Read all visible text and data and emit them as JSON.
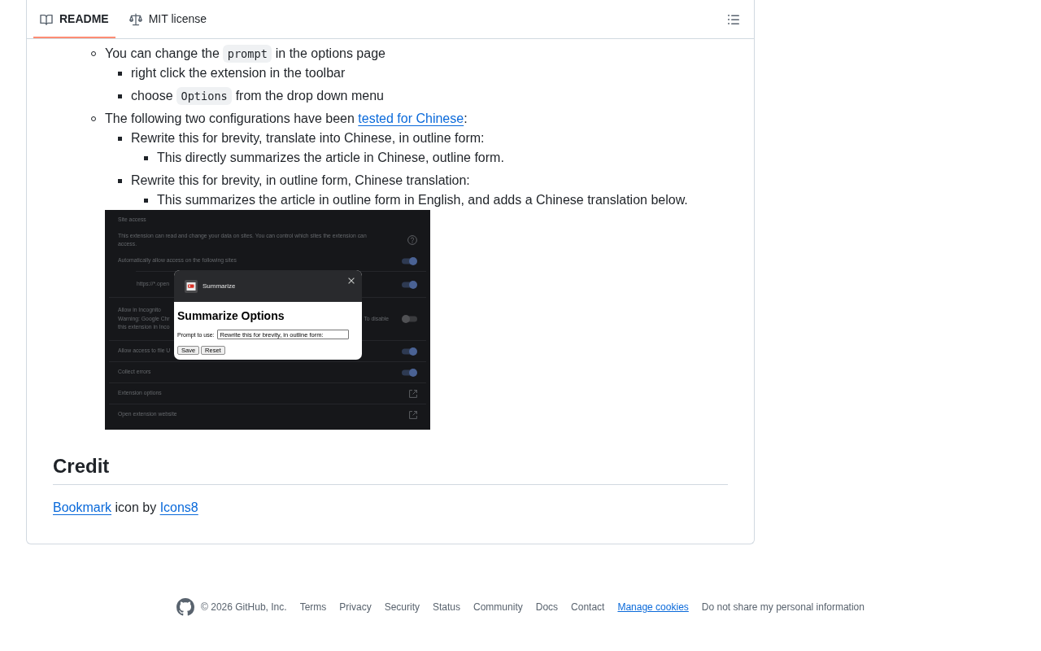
{
  "tabs": [
    {
      "label": "README",
      "selected": true
    },
    {
      "label": "MIT license",
      "selected": false
    }
  ],
  "readme": {
    "list": [
      {
        "parts": [
          {
            "kind": "text",
            "text": "You can change the "
          },
          {
            "kind": "code",
            "text": "prompt"
          },
          {
            "kind": "text",
            "text": " in the options page"
          }
        ],
        "children": [
          {
            "parts": [
              {
                "kind": "text",
                "text": "right click the extension in the toolbar"
              }
            ]
          },
          {
            "parts": [
              {
                "kind": "text",
                "text": "choose "
              },
              {
                "kind": "code",
                "text": "Options"
              },
              {
                "kind": "text",
                "text": " from the drop down menu"
              }
            ]
          }
        ]
      },
      {
        "parts": [
          {
            "kind": "text",
            "text": "The following two configurations have been "
          },
          {
            "kind": "link",
            "text": "tested for Chinese"
          },
          {
            "kind": "text",
            "text": ":"
          }
        ],
        "children": [
          {
            "parts": [
              {
                "kind": "text",
                "text": "Rewrite this for brevity, translate into Chinese, in outline form:"
              }
            ],
            "children": [
              {
                "parts": [
                  {
                    "kind": "text",
                    "text": "This directly summarizes the article in Chinese, outline form."
                  }
                ]
              }
            ]
          },
          {
            "parts": [
              {
                "kind": "text",
                "text": "Rewrite this for brevity, in outline form, Chinese translation:"
              }
            ],
            "children": [
              {
                "parts": [
                  {
                    "kind": "text",
                    "text": "This summarizes the article in outline form in English, and adds a Chinese translation below."
                  }
                ]
              }
            ]
          }
        ],
        "screenshot": {
          "section_title": "Site access",
          "description": "This extension can read and change your data on sites. You can control which sites the extension can access.",
          "rows": [
            {
              "kind": "toggle",
              "label": "Automatically allow access on the following sites",
              "on": true,
              "children": [
                {
                  "kind": "toggle",
                  "label": "https://*.open",
                  "on": true
                }
              ]
            },
            {
              "kind": "toggle",
              "label": "Allow in Incognito",
              "note_lines": [
                [
                  "Warning: Google Chr",
                  "To disable"
                ],
                [
                  "this extension in Inco"
                ]
              ],
              "on": false
            },
            {
              "kind": "toggle",
              "label": "Allow access to file U",
              "on": true
            },
            {
              "kind": "toggle",
              "label": "Collect errors",
              "on": true
            },
            {
              "kind": "link",
              "label": "Extension options"
            },
            {
              "kind": "link",
              "label": "Open extension website"
            }
          ],
          "dialog": {
            "title": "Summarize",
            "heading": "Summarize Options",
            "field_label": "Prompt to use:",
            "field_value": "Rewrite this for brevity, in outline form:",
            "buttons": [
              "Save",
              "Reset"
            ]
          }
        }
      }
    ],
    "credit": {
      "heading": "Credit",
      "parts": [
        {
          "kind": "link",
          "text": "Bookmark"
        },
        {
          "kind": "text",
          "text": " icon by "
        },
        {
          "kind": "link",
          "text": "Icons8"
        }
      ]
    }
  },
  "footer": {
    "copyright": "© 2026 GitHub, Inc.",
    "links": [
      {
        "label": "Terms",
        "underlined": false
      },
      {
        "label": "Privacy",
        "underlined": false
      },
      {
        "label": "Security",
        "underlined": false
      },
      {
        "label": "Status",
        "underlined": false
      },
      {
        "label": "Community",
        "underlined": false
      },
      {
        "label": "Docs",
        "underlined": false
      },
      {
        "label": "Contact",
        "underlined": false
      },
      {
        "label": "Manage cookies",
        "underlined": true
      },
      {
        "label": "Do not share my personal information",
        "underlined": false
      }
    ]
  }
}
